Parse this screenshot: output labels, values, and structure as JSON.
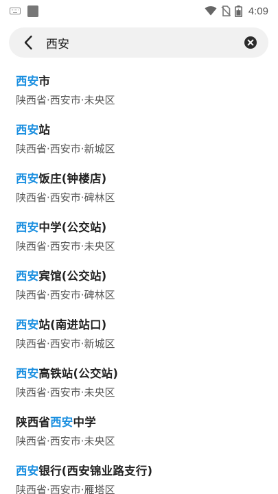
{
  "status_bar": {
    "time": "4:09",
    "icons": [
      "keyboard-icon",
      "app-icon",
      "wifi-icon",
      "no-sim-icon",
      "battery-icon"
    ]
  },
  "search": {
    "query": "西安",
    "icons": {
      "back": "back-arrow-icon",
      "clear": "clear-icon"
    }
  },
  "colors": {
    "highlight": "#1a8fe0",
    "title": "#222222",
    "address": "#555555",
    "search_bg": "#f1f1f1"
  },
  "results": [
    {
      "pre": "",
      "hl": "西安",
      "post": "市",
      "address": "陕西省·西安市·未央区"
    },
    {
      "pre": "",
      "hl": "西安",
      "post": "站",
      "address": "陕西省·西安市·新城区"
    },
    {
      "pre": "",
      "hl": "西安",
      "post": "饭庄(钟楼店)",
      "address": "陕西省·西安市·碑林区"
    },
    {
      "pre": "",
      "hl": "西安",
      "post": "中学(公交站)",
      "address": "陕西省·西安市·未央区"
    },
    {
      "pre": "",
      "hl": "西安",
      "post": "宾馆(公交站)",
      "address": "陕西省·西安市·碑林区"
    },
    {
      "pre": "",
      "hl": "西安",
      "post": "站(南进站口)",
      "address": "陕西省·西安市·新城区"
    },
    {
      "pre": "",
      "hl": "西安",
      "post": "高铁站(公交站)",
      "address": "陕西省·西安市·未央区"
    },
    {
      "pre": "陕西省",
      "hl": "西安",
      "post": "中学",
      "address": "陕西省·西安市·未央区"
    },
    {
      "pre": "",
      "hl": "西安",
      "post": "银行(西安锦业路支行)",
      "address": "陕西省·西安市·雁塔区"
    }
  ]
}
